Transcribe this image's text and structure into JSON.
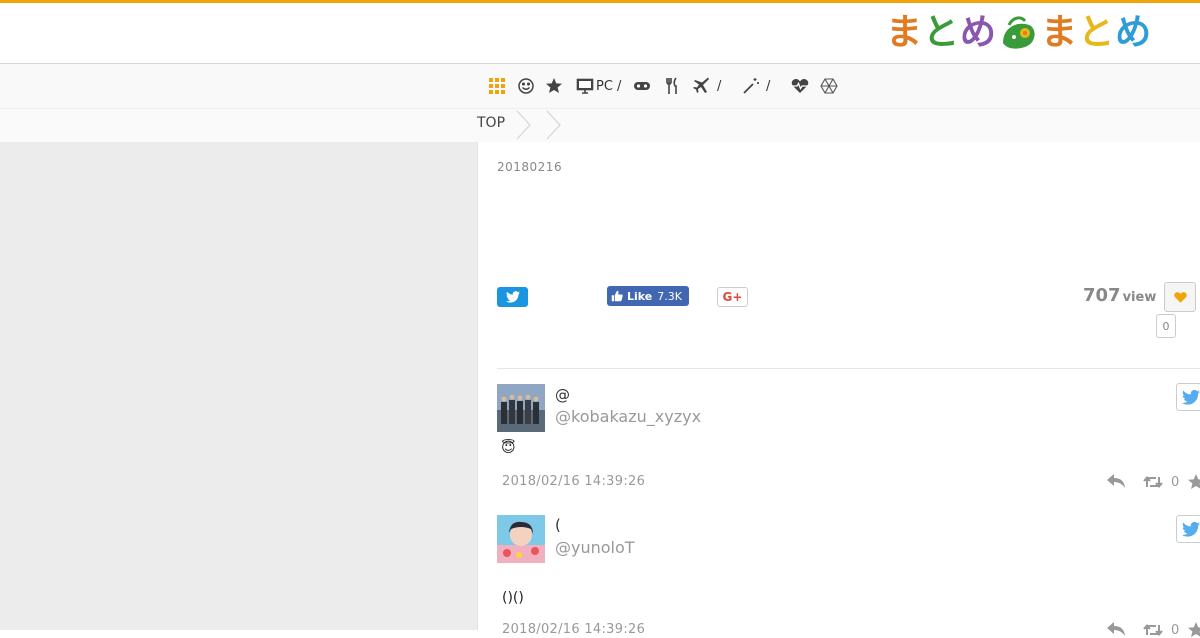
{
  "colors": {
    "accent": "#f0a30a",
    "twitter": "#1b95e0",
    "facebook": "#4267b2",
    "gplus": "#dd4b39"
  },
  "logo": {
    "chars": [
      {
        "text": "ま",
        "color": "#e07b1f"
      },
      {
        "text": "と",
        "color": "#3a9b3a"
      },
      {
        "text": "め",
        "color": "#8a56b0"
      },
      {
        "text": "ま",
        "color": "#e07b1f"
      },
      {
        "text": "と",
        "color": "#e8b71a"
      },
      {
        "text": "め",
        "color": "#2f9bd8"
      }
    ],
    "mascot_icon": "leaf-mascot-icon"
  },
  "nav": {
    "items": [
      {
        "icon": "grid-icon",
        "label": ""
      },
      {
        "icon": "smile-icon",
        "label": ""
      },
      {
        "icon": "star-icon",
        "label": ""
      },
      {
        "icon": "monitor-icon",
        "label": "PC /"
      },
      {
        "icon": "gamepad-icon",
        "label": ""
      },
      {
        "icon": "cutlery-icon",
        "label": ""
      },
      {
        "icon": "plane-icon",
        "label": "/"
      },
      {
        "icon": "magic-wand-icon",
        "label": "/"
      },
      {
        "icon": "heartbeat-icon",
        "label": ""
      },
      {
        "icon": "hexagon-icon",
        "label": ""
      }
    ]
  },
  "breadcrumb": {
    "items": [
      "TOP"
    ]
  },
  "article": {
    "date": "20180216",
    "share": {
      "fb_like_label": "Like",
      "fb_like_count": "7.3K",
      "gplus_label": "G+"
    },
    "views": {
      "count": "707",
      "label": "view"
    },
    "favorite_count": "0"
  },
  "tweets": [
    {
      "name": "@",
      "handle": "@kobakazu_xyzyx",
      "text": "😇",
      "time": "2018/02/16 14:39:26",
      "retweets": "0"
    },
    {
      "name": "(",
      "handle": "@yunoloT",
      "text": "()()",
      "time": "2018/02/16 14:39:26",
      "retweets": "0"
    }
  ]
}
